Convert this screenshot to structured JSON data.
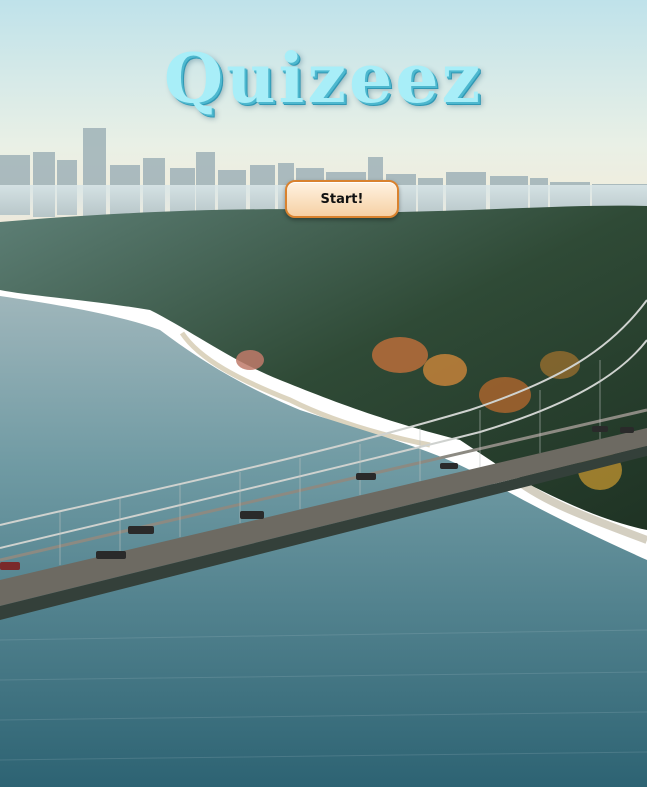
{
  "app": {
    "title": "Quizeez"
  },
  "start": {
    "label": "Start!"
  },
  "colors": {
    "title_fill": "#a8eef8",
    "title_shadow": "#2f98b4",
    "button_border": "#d9822e"
  }
}
